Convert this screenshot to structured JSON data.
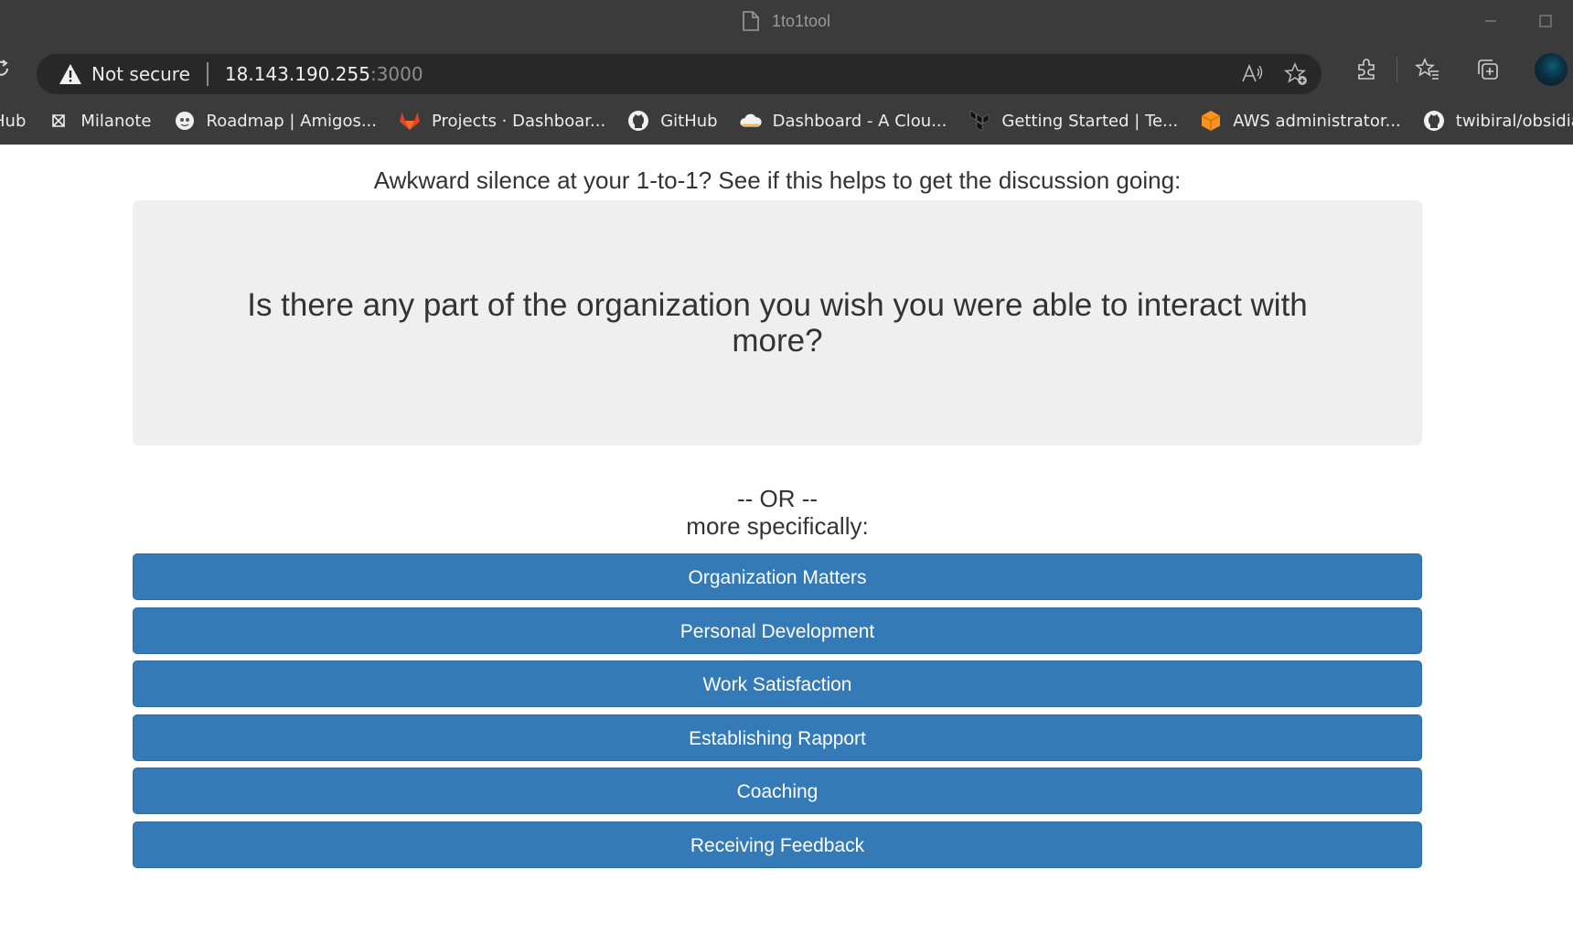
{
  "window": {
    "title": "1to1tool"
  },
  "addressbar": {
    "security_label": "Not secure",
    "url_host": "18.143.190.255",
    "url_port": ":3000"
  },
  "bookmarks": [
    {
      "label": "Hub",
      "icon": "hub-icon"
    },
    {
      "label": "Milanote",
      "icon": "milanote-icon"
    },
    {
      "label": "Roadmap | Amigos...",
      "icon": "amigos-icon"
    },
    {
      "label": "Projects · Dashboar...",
      "icon": "gitlab-icon"
    },
    {
      "label": "GitHub",
      "icon": "github-icon"
    },
    {
      "label": "Dashboard - A Clou...",
      "icon": "cloud-icon"
    },
    {
      "label": "Getting Started | Te...",
      "icon": "terraform-icon"
    },
    {
      "label": "AWS administrator...",
      "icon": "aws-icon"
    },
    {
      "label": "twibiral/obsidian-ex...",
      "icon": "github-icon"
    }
  ],
  "main": {
    "intro": "Awkward silence at your 1-to-1? See if this helps to get the discussion going:",
    "question": "Is there any part of the organization you wish you were able to interact with more?",
    "or_line": "-- OR --",
    "specific_line": "more specifically:",
    "categories": [
      "Organization Matters",
      "Personal Development",
      "Work Satisfaction",
      "Establishing Rapport",
      "Coaching",
      "Receiving Feedback"
    ]
  },
  "colors": {
    "button_bg": "#337ab7",
    "card_bg": "#efefef",
    "chrome_bg": "#3b3b3b",
    "gitlab": "#e24329",
    "aws": "#f7931e"
  }
}
